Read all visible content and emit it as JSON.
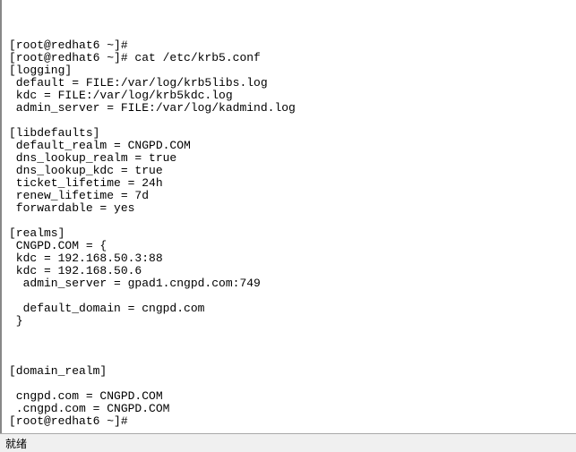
{
  "terminal": {
    "lines": [
      "",
      "",
      "[root@redhat6 ~]#",
      "[root@redhat6 ~]# cat /etc/krb5.conf",
      "[logging]",
      " default = FILE:/var/log/krb5libs.log",
      " kdc = FILE:/var/log/krb5kdc.log",
      " admin_server = FILE:/var/log/kadmind.log",
      "",
      "[libdefaults]",
      " default_realm = CNGPD.COM",
      " dns_lookup_realm = true",
      " dns_lookup_kdc = true",
      " ticket_lifetime = 24h",
      " renew_lifetime = 7d",
      " forwardable = yes",
      "",
      "[realms]",
      " CNGPD.COM = {",
      " kdc = 192.168.50.3:88",
      " kdc = 192.168.50.6",
      "  admin_server = gpad1.cngpd.com:749",
      "",
      "  default_domain = cngpd.com",
      " }",
      "",
      "",
      "",
      "[domain_realm]",
      "",
      " cngpd.com = CNGPD.COM",
      " .cngpd.com = CNGPD.COM",
      "[root@redhat6 ~]#"
    ]
  },
  "status": {
    "label": "就绪"
  }
}
